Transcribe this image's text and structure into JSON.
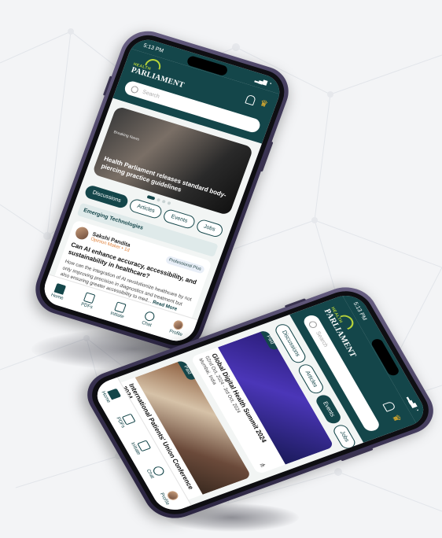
{
  "phone1": {
    "status_time": "5:13 PM",
    "logo_line1": "HEALTH",
    "logo_line2": "PARLIAMENT",
    "search_placeholder": "Search",
    "hero": {
      "tag": "Breaking News",
      "title": "Health Parliament releases standard body-piercing practice guidelines"
    },
    "tabs": [
      "Discussions",
      "Articles",
      "Events",
      "Jobs"
    ],
    "section": "Emerging Technologies",
    "post": {
      "author": "Sakshi Pandita",
      "role": "Opinion Maker",
      "time": "• 1d",
      "badge": "Professional Plus",
      "question": "Can AI enhance accuracy, accessibility, and sustainability in healthcare?",
      "body": "How can the integration of AI revolutionize healthcare by not only improving precision in diagnostics and treatment but also ensuring greater accessibility to med...",
      "read_more": "Read More"
    },
    "nav": [
      "Home",
      "PDFs",
      "Initiate",
      "Chat",
      "Profile"
    ]
  },
  "phone2": {
    "status_time": "5:13 PM",
    "logo_line1": "HEALTH",
    "logo_line2": "PARLIAMENT",
    "search_placeholder": "Search",
    "tabs": [
      "Discussions",
      "Articles",
      "Events",
      "Jobs"
    ],
    "cards": [
      {
        "badge": "Paid",
        "title": "Global Digital Health Summit 2024",
        "date": "02nd Oct, 2024 - 3rd Oct, 2024",
        "location": "Mumbai, India"
      },
      {
        "badge": "Paid",
        "title": "International Patients' Union Conference 2024",
        "date": "",
        "location": ""
      }
    ],
    "nav": [
      "Home",
      "PDFs",
      "Initiate",
      "Chat",
      "Profile"
    ]
  },
  "colors": {
    "brand": "#14464a",
    "accent": "#b6d33a",
    "crown": "#f3b72b",
    "background": "#f3f4f6"
  }
}
